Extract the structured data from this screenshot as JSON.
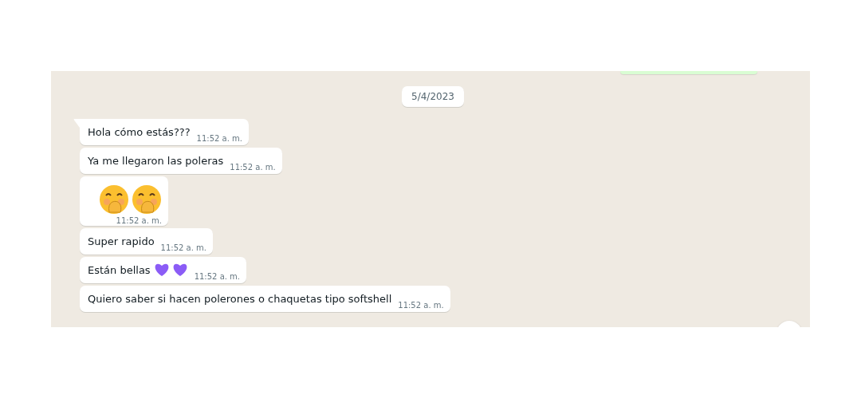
{
  "date_chip": "5/4/2023",
  "messages": [
    {
      "kind": "text",
      "text": "Hola cómo estás???",
      "time": "11:52 a. m.",
      "tail": true
    },
    {
      "kind": "text",
      "text": "Ya me llegaron las poleras",
      "time": "11:52 a. m.",
      "tail": false
    },
    {
      "kind": "emoji",
      "time": "11:52 a. m.",
      "tail": false
    },
    {
      "kind": "text",
      "text": "Super rapido",
      "time": "11:52 a. m.",
      "tail": false
    },
    {
      "kind": "hearts",
      "text": "Están bellas",
      "time": "11:52 a. m.",
      "tail": false
    },
    {
      "kind": "text",
      "text": "Quiero saber si hacen polerones o chaquetas tipo softshell",
      "time": "11:52 a. m.",
      "tail": false
    }
  ]
}
